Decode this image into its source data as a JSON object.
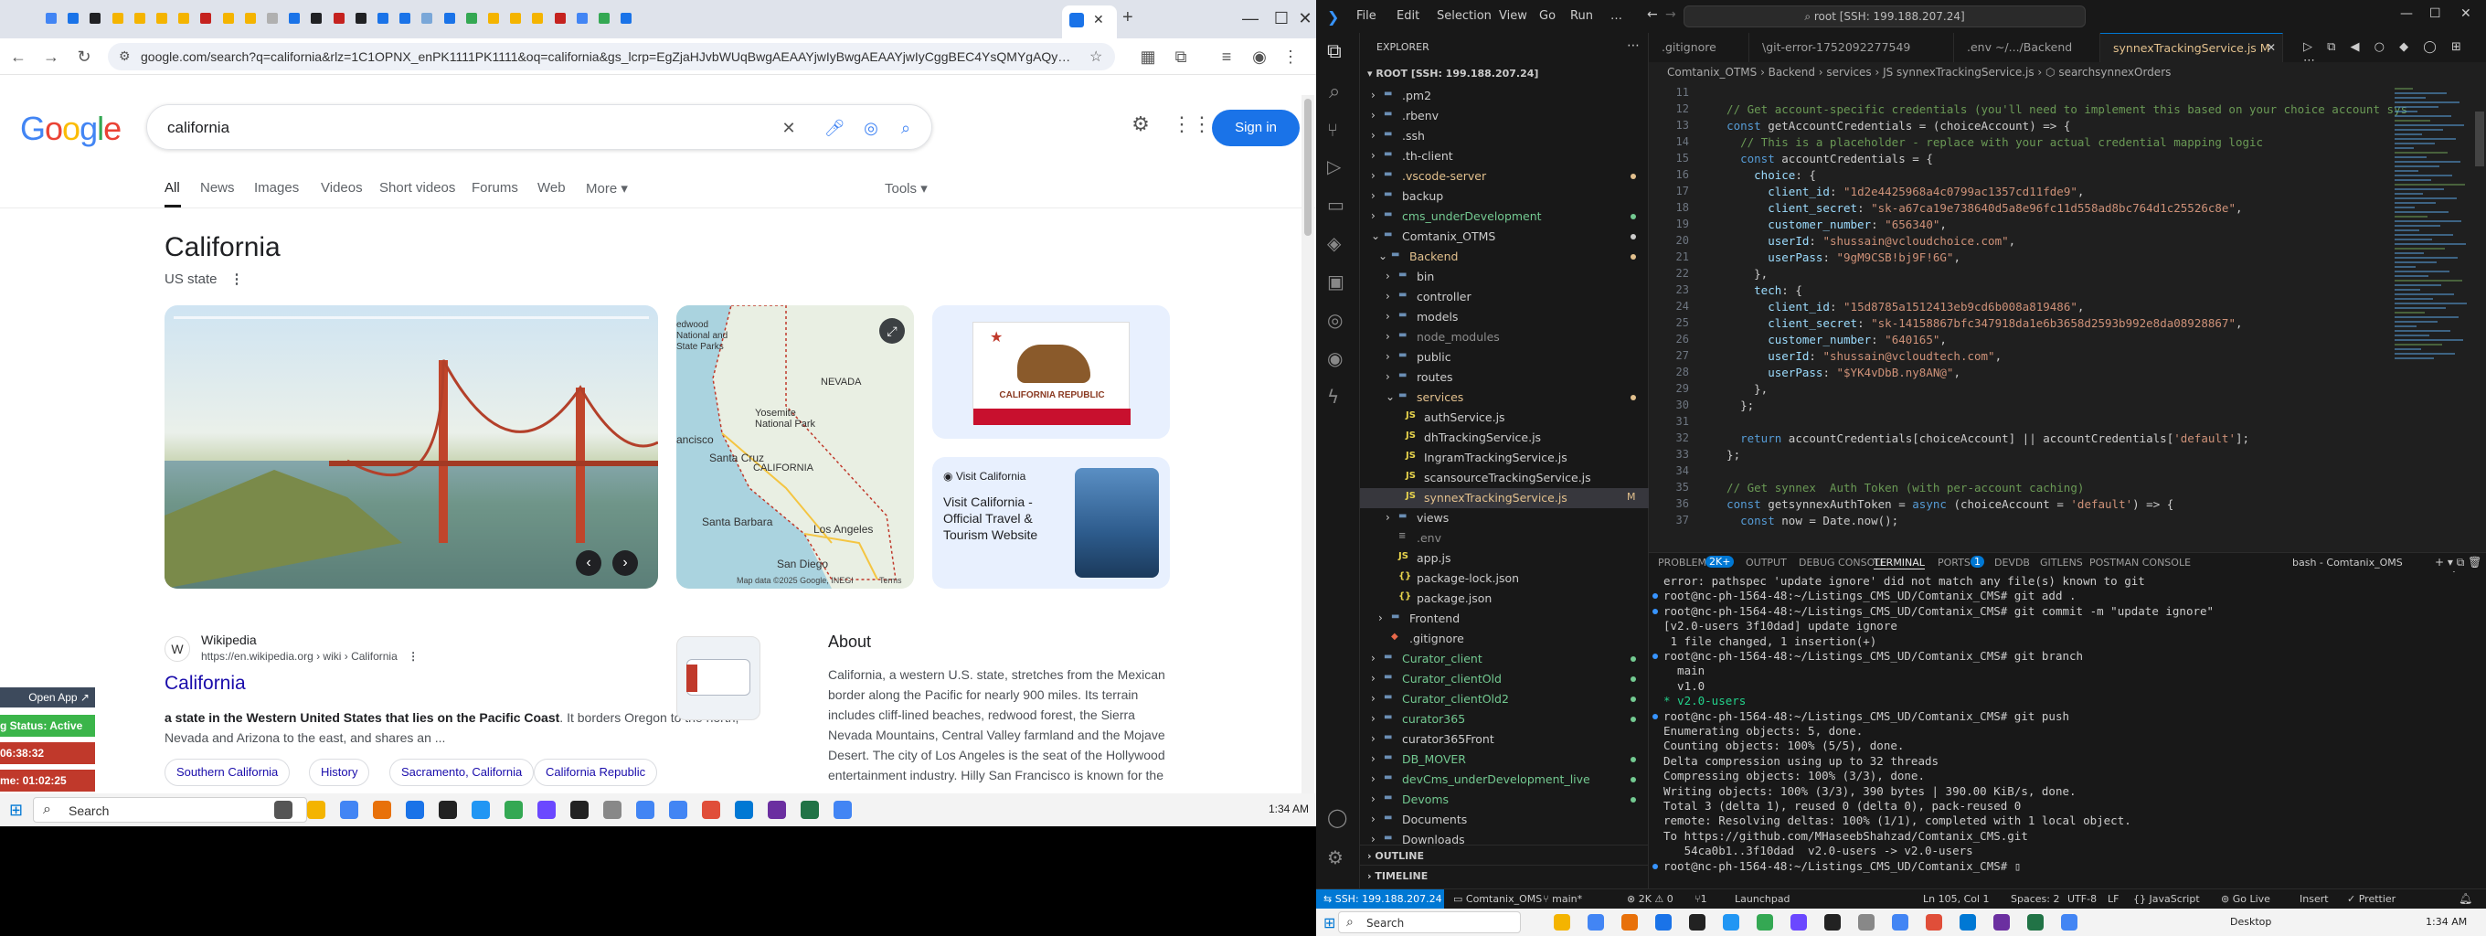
{
  "chrome": {
    "url": "google.com/search?q=california&rlz=1C1OPNX_enPK1111PK1111&oq=california&gs_lcrp=EgZjaHJvbWUqBwgAEAAYjwIyBwgAEAAYjwIyCggBEC4YsQMYgAQyCggC...",
    "active_tab_close": "✕",
    "new_tab": "+",
    "window_controls": [
      "—",
      "☐",
      "✕"
    ]
  },
  "google": {
    "logo": "Google",
    "query": "california",
    "signin": "Sign in",
    "tabs": [
      "All",
      "News",
      "Images",
      "Videos",
      "Short videos",
      "Forums",
      "Web",
      "More",
      "Tools"
    ],
    "title": "California",
    "subtitle": "US state",
    "map_attribution": "Map data ©2025 Google, INEGI",
    "map_terms": "Terms",
    "map_labels": [
      "NEVADA",
      "Yosemite National Park",
      "ancisco",
      "Santa Cruz",
      "CALIFORNIA",
      "Santa Barbara",
      "Los Angeles",
      "San Diego",
      "edwood National and State Parks"
    ],
    "flag_text": "CALIFORNIA REPUBLIC",
    "visit_label": "Visit California",
    "visit_desc": "Visit California - Official Travel & Tourism Website",
    "wiki_source": "Wikipedia",
    "wiki_url": "https://en.wikipedia.org › wiki › California",
    "wiki_title": "California",
    "wiki_snippet_bold": "a state in the Western United States that lies on the Pacific Coast",
    "wiki_snippet_rest": ". It borders Oregon to the north, Nevada and Arizona to the east, and shares an ...",
    "chips": [
      "Southern California",
      "History",
      "Sacramento, California",
      "California Republic"
    ],
    "about_title": "About",
    "about_text": "California, a western U.S. state, stretches from the Mexican border along the Pacific for nearly 900 miles. Its terrain includes cliff-lined beaches, redwood forest, the Sierra Nevada Mountains, Central Valley farmland and the Mojave Desert. The city of Los Angeles is the seat of the Hollywood entertainment industry. Hilly San Francisco is known for the"
  },
  "sidepanel": {
    "open_app": "Open App ↗",
    "status": "g Status: Active",
    "time1": "06:38:32",
    "time2": "me: 01:02:25"
  },
  "taskbar_left": {
    "search": "Search",
    "time": "1:34 AM"
  },
  "vscode": {
    "menu": [
      "File",
      "Edit",
      "Selection",
      "View",
      "Go",
      "Run",
      "…"
    ],
    "search_box": "root [SSH: 199.188.207.24]",
    "tabs": [
      {
        "label": ".gitignore",
        "active": false
      },
      {
        "label": "\\git-error-1752092277549",
        "active": false
      },
      {
        "label": ".env ~/.../Backend",
        "active": false
      },
      {
        "label": "synnexTrackingService.js M",
        "active": true
      }
    ],
    "breadcrumb": "Comtanix_OTMS › Backend › services › JS synnexTrackingService.js › ⬡ searchsynnexOrders",
    "explorer_title": "EXPLORER",
    "root_label": "ROOT [SSH: 199.188.207.24]",
    "tree": [
      {
        "t": ".pm2",
        "d": 1,
        "k": "folder",
        "c": "#cccccc"
      },
      {
        "t": ".rbenv",
        "d": 1,
        "k": "folder",
        "c": "#cccccc"
      },
      {
        "t": ".ssh",
        "d": 1,
        "k": "folder",
        "c": "#cccccc"
      },
      {
        "t": ".th-client",
        "d": 1,
        "k": "folder",
        "c": "#cccccc"
      },
      {
        "t": ".vscode-server",
        "d": 1,
        "k": "folder",
        "c": "#e2c08d",
        "dot": true
      },
      {
        "t": "backup",
        "d": 1,
        "k": "folder",
        "c": "#cccccc"
      },
      {
        "t": "cms_underDevelopment",
        "d": 1,
        "k": "folder",
        "c": "#73c991",
        "dot": true
      },
      {
        "t": "Comtanix_OTMS",
        "d": 1,
        "k": "folder-open",
        "c": "#cccccc",
        "dot": true
      },
      {
        "t": "Backend",
        "d": 2,
        "k": "folder-open",
        "c": "#e2c08d",
        "dot": true
      },
      {
        "t": "bin",
        "d": 3,
        "k": "folder",
        "c": "#cccccc"
      },
      {
        "t": "controller",
        "d": 3,
        "k": "folder",
        "c": "#cccccc"
      },
      {
        "t": "models",
        "d": 3,
        "k": "folder",
        "c": "#cccccc"
      },
      {
        "t": "node_modules",
        "d": 3,
        "k": "folder",
        "c": "#8c8c8c"
      },
      {
        "t": "public",
        "d": 3,
        "k": "folder",
        "c": "#cccccc"
      },
      {
        "t": "routes",
        "d": 3,
        "k": "folder",
        "c": "#cccccc"
      },
      {
        "t": "services",
        "d": 3,
        "k": "folder-open",
        "c": "#e2c08d",
        "dot": true
      },
      {
        "t": "authService.js",
        "d": 4,
        "k": "js",
        "c": "#cccccc"
      },
      {
        "t": "dhTrackingService.js",
        "d": 4,
        "k": "js",
        "c": "#cccccc"
      },
      {
        "t": "IngramTrackingService.js",
        "d": 4,
        "k": "js",
        "c": "#cccccc"
      },
      {
        "t": "scansourceTrackingService.js",
        "d": 4,
        "k": "js",
        "c": "#cccccc"
      },
      {
        "t": "synnexTrackingService.js",
        "d": 4,
        "k": "js",
        "c": "#e2c08d",
        "sel": true,
        "badge": "M"
      },
      {
        "t": "views",
        "d": 3,
        "k": "folder",
        "c": "#cccccc"
      },
      {
        "t": ".env",
        "d": 3,
        "k": "file",
        "c": "#8c8c8c"
      },
      {
        "t": "app.js",
        "d": 3,
        "k": "js",
        "c": "#cccccc"
      },
      {
        "t": "package-lock.json",
        "d": 3,
        "k": "json",
        "c": "#cccccc"
      },
      {
        "t": "package.json",
        "d": 3,
        "k": "json",
        "c": "#cccccc"
      },
      {
        "t": "Frontend",
        "d": 2,
        "k": "folder",
        "c": "#cccccc"
      },
      {
        "t": ".gitignore",
        "d": 2,
        "k": "git",
        "c": "#cccccc"
      },
      {
        "t": "Curator_client",
        "d": 1,
        "k": "folder",
        "c": "#73c991",
        "dot": true
      },
      {
        "t": "Curator_clientOld",
        "d": 1,
        "k": "folder",
        "c": "#73c991",
        "dot": true
      },
      {
        "t": "Curator_clientOld2",
        "d": 1,
        "k": "folder",
        "c": "#73c991",
        "dot": true
      },
      {
        "t": "curator365",
        "d": 1,
        "k": "folder",
        "c": "#73c991",
        "dot": true
      },
      {
        "t": "curator365Front",
        "d": 1,
        "k": "folder",
        "c": "#cccccc"
      },
      {
        "t": "DB_MOVER",
        "d": 1,
        "k": "folder",
        "c": "#73c991",
        "dot": true
      },
      {
        "t": "devCms_underDevelopment_live",
        "d": 1,
        "k": "folder",
        "c": "#73c991",
        "dot": true
      },
      {
        "t": "Devoms",
        "d": 1,
        "k": "folder",
        "c": "#73c991",
        "dot": true
      },
      {
        "t": "Documents",
        "d": 1,
        "k": "folder",
        "c": "#cccccc"
      },
      {
        "t": "Downloads",
        "d": 1,
        "k": "folder",
        "c": "#cccccc"
      }
    ],
    "outline": "OUTLINE",
    "timeline": "TIMELINE",
    "code_lines": [
      {
        "n": "11",
        "s": ""
      },
      {
        "n": "12",
        "s": "  // Get account-specific credentials (you'll need to implement this based on your choice account sys",
        "cls": "cm"
      },
      {
        "n": "13",
        "s": "  const getAccountCredentials = (choiceAccount) => {"
      },
      {
        "n": "14",
        "s": "    // This is a placeholder - replace with your actual credential mapping logic",
        "cls": "cm"
      },
      {
        "n": "15",
        "s": "    const accountCredentials = {"
      },
      {
        "n": "16",
        "s": "      choice: {"
      },
      {
        "n": "17",
        "s": "        client_id: \"1d2e4425968a4c0799ac1357cd11fde9\","
      },
      {
        "n": "18",
        "s": "        client_secret: \"sk-a67ca19e738640d5a8e96fc11d558ad8bc764d1c25526c8e\","
      },
      {
        "n": "19",
        "s": "        customer_number: \"656340\","
      },
      {
        "n": "20",
        "s": "        userId: \"shussain@vcloudchoice.com\","
      },
      {
        "n": "21",
        "s": "        userPass: \"9gM9CSB!bj9F!6G\","
      },
      {
        "n": "22",
        "s": "      },"
      },
      {
        "n": "23",
        "s": "      tech: {"
      },
      {
        "n": "24",
        "s": "        client_id: \"15d8785a1512413eb9cd6b008a819486\","
      },
      {
        "n": "25",
        "s": "        client_secret: \"sk-14158867bfc347918da1e6b3658d2593b992e8da08928867\","
      },
      {
        "n": "26",
        "s": "        customer_number: \"640165\","
      },
      {
        "n": "27",
        "s": "        userId: \"shussain@vcloudtech.com\","
      },
      {
        "n": "28",
        "s": "        userPass: \"$YK4vDbB.ny8AN@\","
      },
      {
        "n": "29",
        "s": "      },"
      },
      {
        "n": "30",
        "s": "    };"
      },
      {
        "n": "31",
        "s": ""
      },
      {
        "n": "32",
        "s": "    return accountCredentials[choiceAccount] || accountCredentials['default'];"
      },
      {
        "n": "33",
        "s": "  };"
      },
      {
        "n": "34",
        "s": ""
      },
      {
        "n": "35",
        "s": "  // Get synnex  Auth Token (with per-account caching)",
        "cls": "cm"
      },
      {
        "n": "36",
        "s": "  const getsynnexAuthToken = async (choiceAccount = 'default') => {"
      },
      {
        "n": "37",
        "s": "    const now = Date.now();"
      }
    ],
    "panel_tabs": [
      "PROBLEMS",
      "2K+",
      "OUTPUT",
      "DEBUG CONSOLE",
      "TERMINAL",
      "PORTS",
      "1",
      "DEVDB",
      "GITLENS",
      "POSTMAN CONSOLE"
    ],
    "terminal_name": "bash - Comtanix_OMS",
    "terminal": [
      {
        "s": "error: pathspec 'update ignore' did not match any file(s) known to git"
      },
      {
        "s": "root@nc-ph-1564-48:~/Listings_CMS_UD/Comtanix_CMS# git add ."
      },
      {
        "s": "root@nc-ph-1564-48:~/Listings_CMS_UD/Comtanix_CMS# git commit -m \"update ignore\""
      },
      {
        "s": "[v2.0-users 3f10dad] update ignore"
      },
      {
        "s": " 1 file changed, 1 insertion(+)"
      },
      {
        "s": "root@nc-ph-1564-48:~/Listings_CMS_UD/Comtanix_CMS# git branch"
      },
      {
        "s": "  main"
      },
      {
        "s": "  v1.0"
      },
      {
        "s": "* v2.0-users",
        "c": "#23d18b"
      },
      {
        "s": "root@nc-ph-1564-48:~/Listings_CMS_UD/Comtanix_CMS# git push"
      },
      {
        "s": "Enumerating objects: 5, done."
      },
      {
        "s": "Counting objects: 100% (5/5), done."
      },
      {
        "s": "Delta compression using up to 32 threads"
      },
      {
        "s": "Compressing objects: 100% (3/3), done."
      },
      {
        "s": "Writing objects: 100% (3/3), 390 bytes | 390.00 KiB/s, done."
      },
      {
        "s": "Total 3 (delta 1), reused 0 (delta 0), pack-reused 0"
      },
      {
        "s": "remote: Resolving deltas: 100% (1/1), completed with 1 local object."
      },
      {
        "s": "To https://github.com/MHaseebShahzad/Comtanix_CMS.git"
      },
      {
        "s": "   54ca0b1..3f10dad  v2.0-users -> v2.0-users"
      },
      {
        "s": "root@nc-ph-1564-48:~/Listings_CMS_UD/Comtanix_CMS# ▯"
      }
    ],
    "status": {
      "ssh": "SSH: 199.188.207.24",
      "folder": "Comtanix_OMS",
      "branch": "main*",
      "errors": "⊗ 2K ⚠ 0",
      "ports": "⑂1",
      "launchpad": "Launchpad",
      "cursor": "Ln 105, Col 1",
      "spaces": "Spaces: 2",
      "enc": "UTF-8",
      "eol": "LF",
      "lang": "{} JavaScript",
      "golive": "Go Live",
      "insert": "Insert",
      "prettier": "Prettier"
    },
    "taskbar": {
      "search": "Search",
      "desktop": "Desktop",
      "time": "1:34 AM"
    }
  }
}
